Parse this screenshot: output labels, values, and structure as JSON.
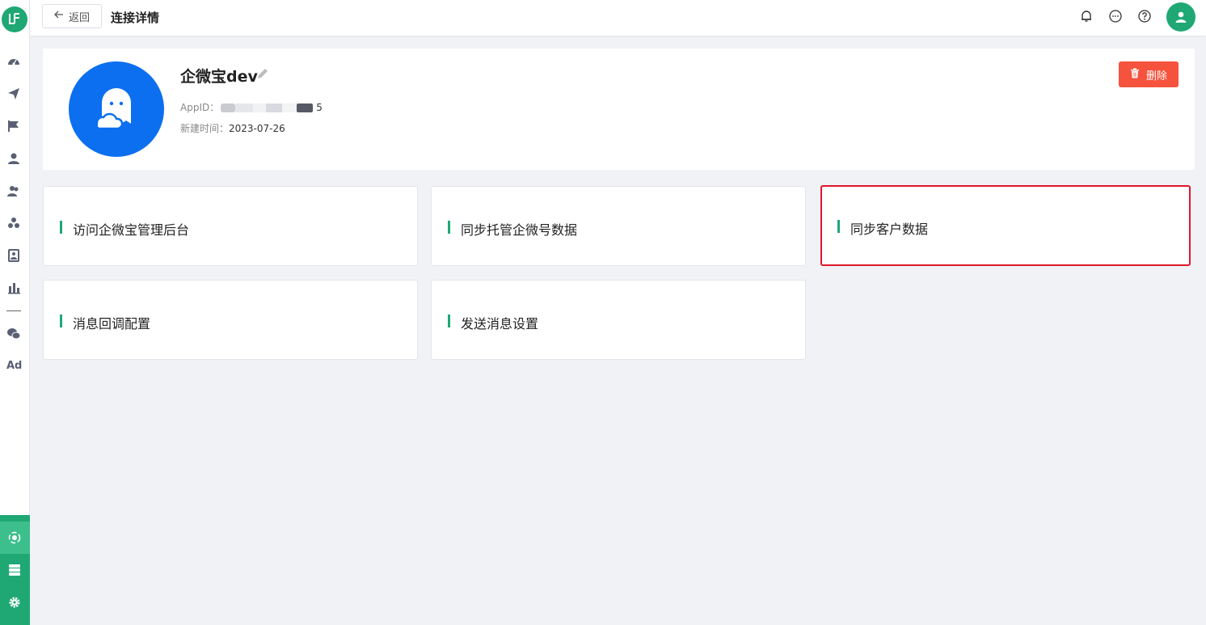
{
  "sidebar": {
    "logo_text": "LF",
    "items": [
      {
        "icon": "dashboard-icon"
      },
      {
        "icon": "send-icon"
      },
      {
        "icon": "flag-icon"
      },
      {
        "icon": "user-icon"
      },
      {
        "icon": "users-icon"
      },
      {
        "icon": "group-icon"
      },
      {
        "icon": "contact-card-icon"
      },
      {
        "icon": "bar-chart-icon"
      },
      {
        "icon": "wechat-icon"
      }
    ],
    "ad_label": "Ad",
    "bottom_items": [
      {
        "icon": "integration-icon"
      },
      {
        "icon": "server-icon"
      },
      {
        "icon": "settings-icon"
      }
    ]
  },
  "header": {
    "back_label": "返回",
    "title": "连接详情"
  },
  "profile": {
    "name": "企微宝dev",
    "appid_label": "AppID：",
    "appid_tail": "5",
    "created_label": "新建时间：",
    "created_value": "2023-07-26",
    "delete_label": "删除"
  },
  "actions": [
    {
      "label": "访问企微宝管理后台"
    },
    {
      "label": "同步托管企微号数据"
    },
    {
      "label": "同步客户数据"
    },
    {
      "label": "消息回调配置"
    },
    {
      "label": "发送消息设置"
    }
  ],
  "colors": {
    "brand": "#1fa874",
    "danger": "#f5533d",
    "avatar_blue": "#0b6ff0",
    "highlight": "#e0162c"
  }
}
